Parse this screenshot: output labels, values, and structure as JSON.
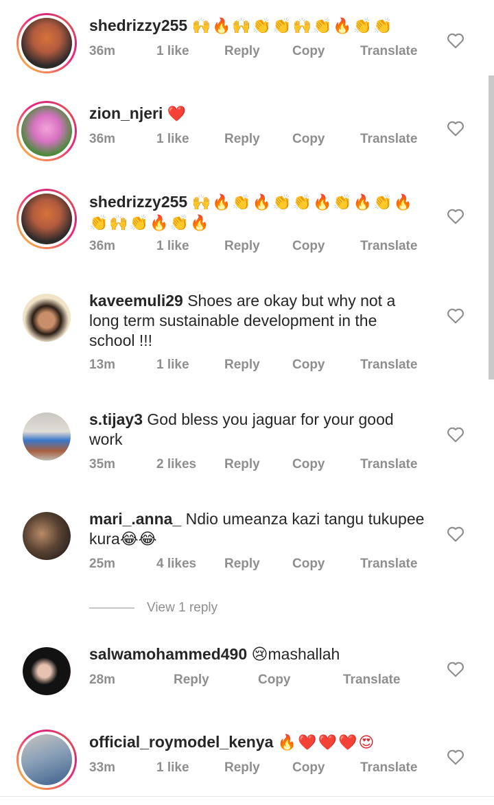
{
  "comments": [
    {
      "username": "shedrizzy255",
      "body": "",
      "emoji_line1": "🙌🔥🙌👏👏🙌👏🔥👏👏",
      "emoji_line2": "",
      "time": "36m",
      "likes": "1 like",
      "reply": "Reply",
      "copy": "Copy",
      "translate": "Translate",
      "story_ring": true,
      "avatar_colors": [
        "#b35b3f",
        "#2d2a2a",
        "#d5733a"
      ]
    },
    {
      "username": "zion_njeri",
      "body": "",
      "emoji_line1": "❤️",
      "emoji_line2": "",
      "time": "36m",
      "likes": "1 like",
      "reply": "Reply",
      "copy": "Copy",
      "translate": "Translate",
      "story_ring": true,
      "avatar_colors": [
        "#4b8a3a",
        "#d873c4",
        "#f3a3d6"
      ]
    },
    {
      "username": "shedrizzy255",
      "body": "",
      "emoji_line1": "🙌🔥👏🔥👏👏🔥👏🔥👏🔥",
      "emoji_line2": "👏🙌👏🔥👏🔥",
      "time": "36m",
      "likes": "1 like",
      "reply": "Reply",
      "copy": "Copy",
      "translate": "Translate",
      "story_ring": true,
      "avatar_colors": [
        "#b35b3f",
        "#2d2a2a",
        "#d5733a"
      ]
    },
    {
      "username": "kaveemuli29",
      "body": "Shoes are okay but why not a long term sustainable development in the school !!!",
      "time": "13m",
      "likes": "1 like",
      "reply": "Reply",
      "copy": "Copy",
      "translate": "Translate",
      "story_ring": false,
      "avatar_colors": [
        "#f1e3c8",
        "#2b1d14",
        "#c98f6a"
      ]
    },
    {
      "username": "s.tijay3",
      "body": "God bless you jaguar for your good work",
      "time": "35m",
      "likes": "2 likes",
      "reply": "Reply",
      "copy": "Copy",
      "translate": "Translate",
      "story_ring": false,
      "avatar_colors": [
        "#c9c7c2",
        "#3a77c9",
        "#a86040"
      ]
    },
    {
      "username": "mari_.anna_",
      "body": "Ndio umeanza kazi tangu tukupee kura😂😂",
      "time": "25m",
      "likes": "4 likes",
      "reply": "Reply",
      "copy": "Copy",
      "translate": "Translate",
      "story_ring": false,
      "avatar_colors": [
        "#5a4333",
        "#b98b67",
        "#2d241f"
      ]
    },
    {
      "username": "salwamohammed490",
      "body": "😢mashallah",
      "time": "28m",
      "reply": "Reply",
      "copy": "Copy",
      "translate": "Translate",
      "story_ring": false,
      "avatar_colors": [
        "#121212",
        "#c2313b",
        "#e7c2b0"
      ]
    },
    {
      "username": "official_roymodel_kenya",
      "body": "",
      "emoji_line1": "🔥❤️❤️❤️😍",
      "time": "33m",
      "likes": "1 like",
      "reply": "Reply",
      "copy": "Copy",
      "translate": "Translate",
      "story_ring": true,
      "avatar_colors": [
        "#8aa0b8",
        "#3d5f8a",
        "#c7c3bd"
      ]
    }
  ],
  "view_replies": "View 1 reply",
  "icons": {
    "like": "heart-outline-icon"
  }
}
